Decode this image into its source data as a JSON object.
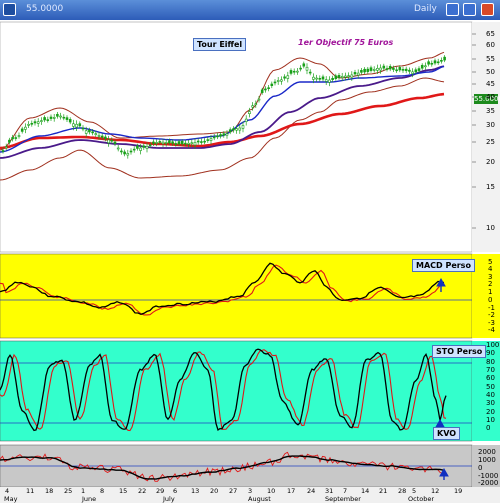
{
  "window": {
    "title": "55.0000",
    "period": "Daily"
  },
  "price_panel": {
    "label_left": "Tour Eiffel",
    "label_right": "1er Objectif 75 Euros",
    "last_price": "55.0000",
    "y_ticks": [
      "65",
      "60",
      "55",
      "50",
      "45",
      "40",
      "35",
      "30",
      "25",
      "20",
      "15",
      "10"
    ]
  },
  "macd_panel": {
    "label": "MACD Perso",
    "y_ticks": [
      "5",
      "4",
      "3",
      "2",
      "1",
      "0",
      "-1",
      "-2",
      "-3",
      "-4"
    ]
  },
  "sto_panel": {
    "label": "STO Perso",
    "y_ticks": [
      "100",
      "90",
      "80",
      "70",
      "60",
      "50",
      "40",
      "30",
      "20",
      "10",
      "0"
    ]
  },
  "kvo_panel": {
    "label": "KVO",
    "y_ticks": [
      "2000",
      "1000",
      "0",
      "-1000",
      "-2000"
    ]
  },
  "date_axis": {
    "days": [
      "4",
      "11",
      "18",
      "25",
      "1",
      "8",
      "15",
      "22",
      "29",
      "6",
      "13",
      "20",
      "27",
      "3",
      "10",
      "17",
      "24",
      "31",
      "7",
      "14",
      "21",
      "28",
      "5",
      "12",
      "19"
    ],
    "months": [
      "May",
      "June",
      "July",
      "August",
      "September",
      "October"
    ]
  },
  "colors": {
    "bollinger": "#a0301e",
    "ma_long": "#e01818",
    "ma_mid": "#4a1a8a",
    "ma_short": "#1a28c8",
    "macd_bg": "#ffff00",
    "sto_bg": "#33ffcc",
    "kvo_bg": "#c8c8c8"
  }
}
